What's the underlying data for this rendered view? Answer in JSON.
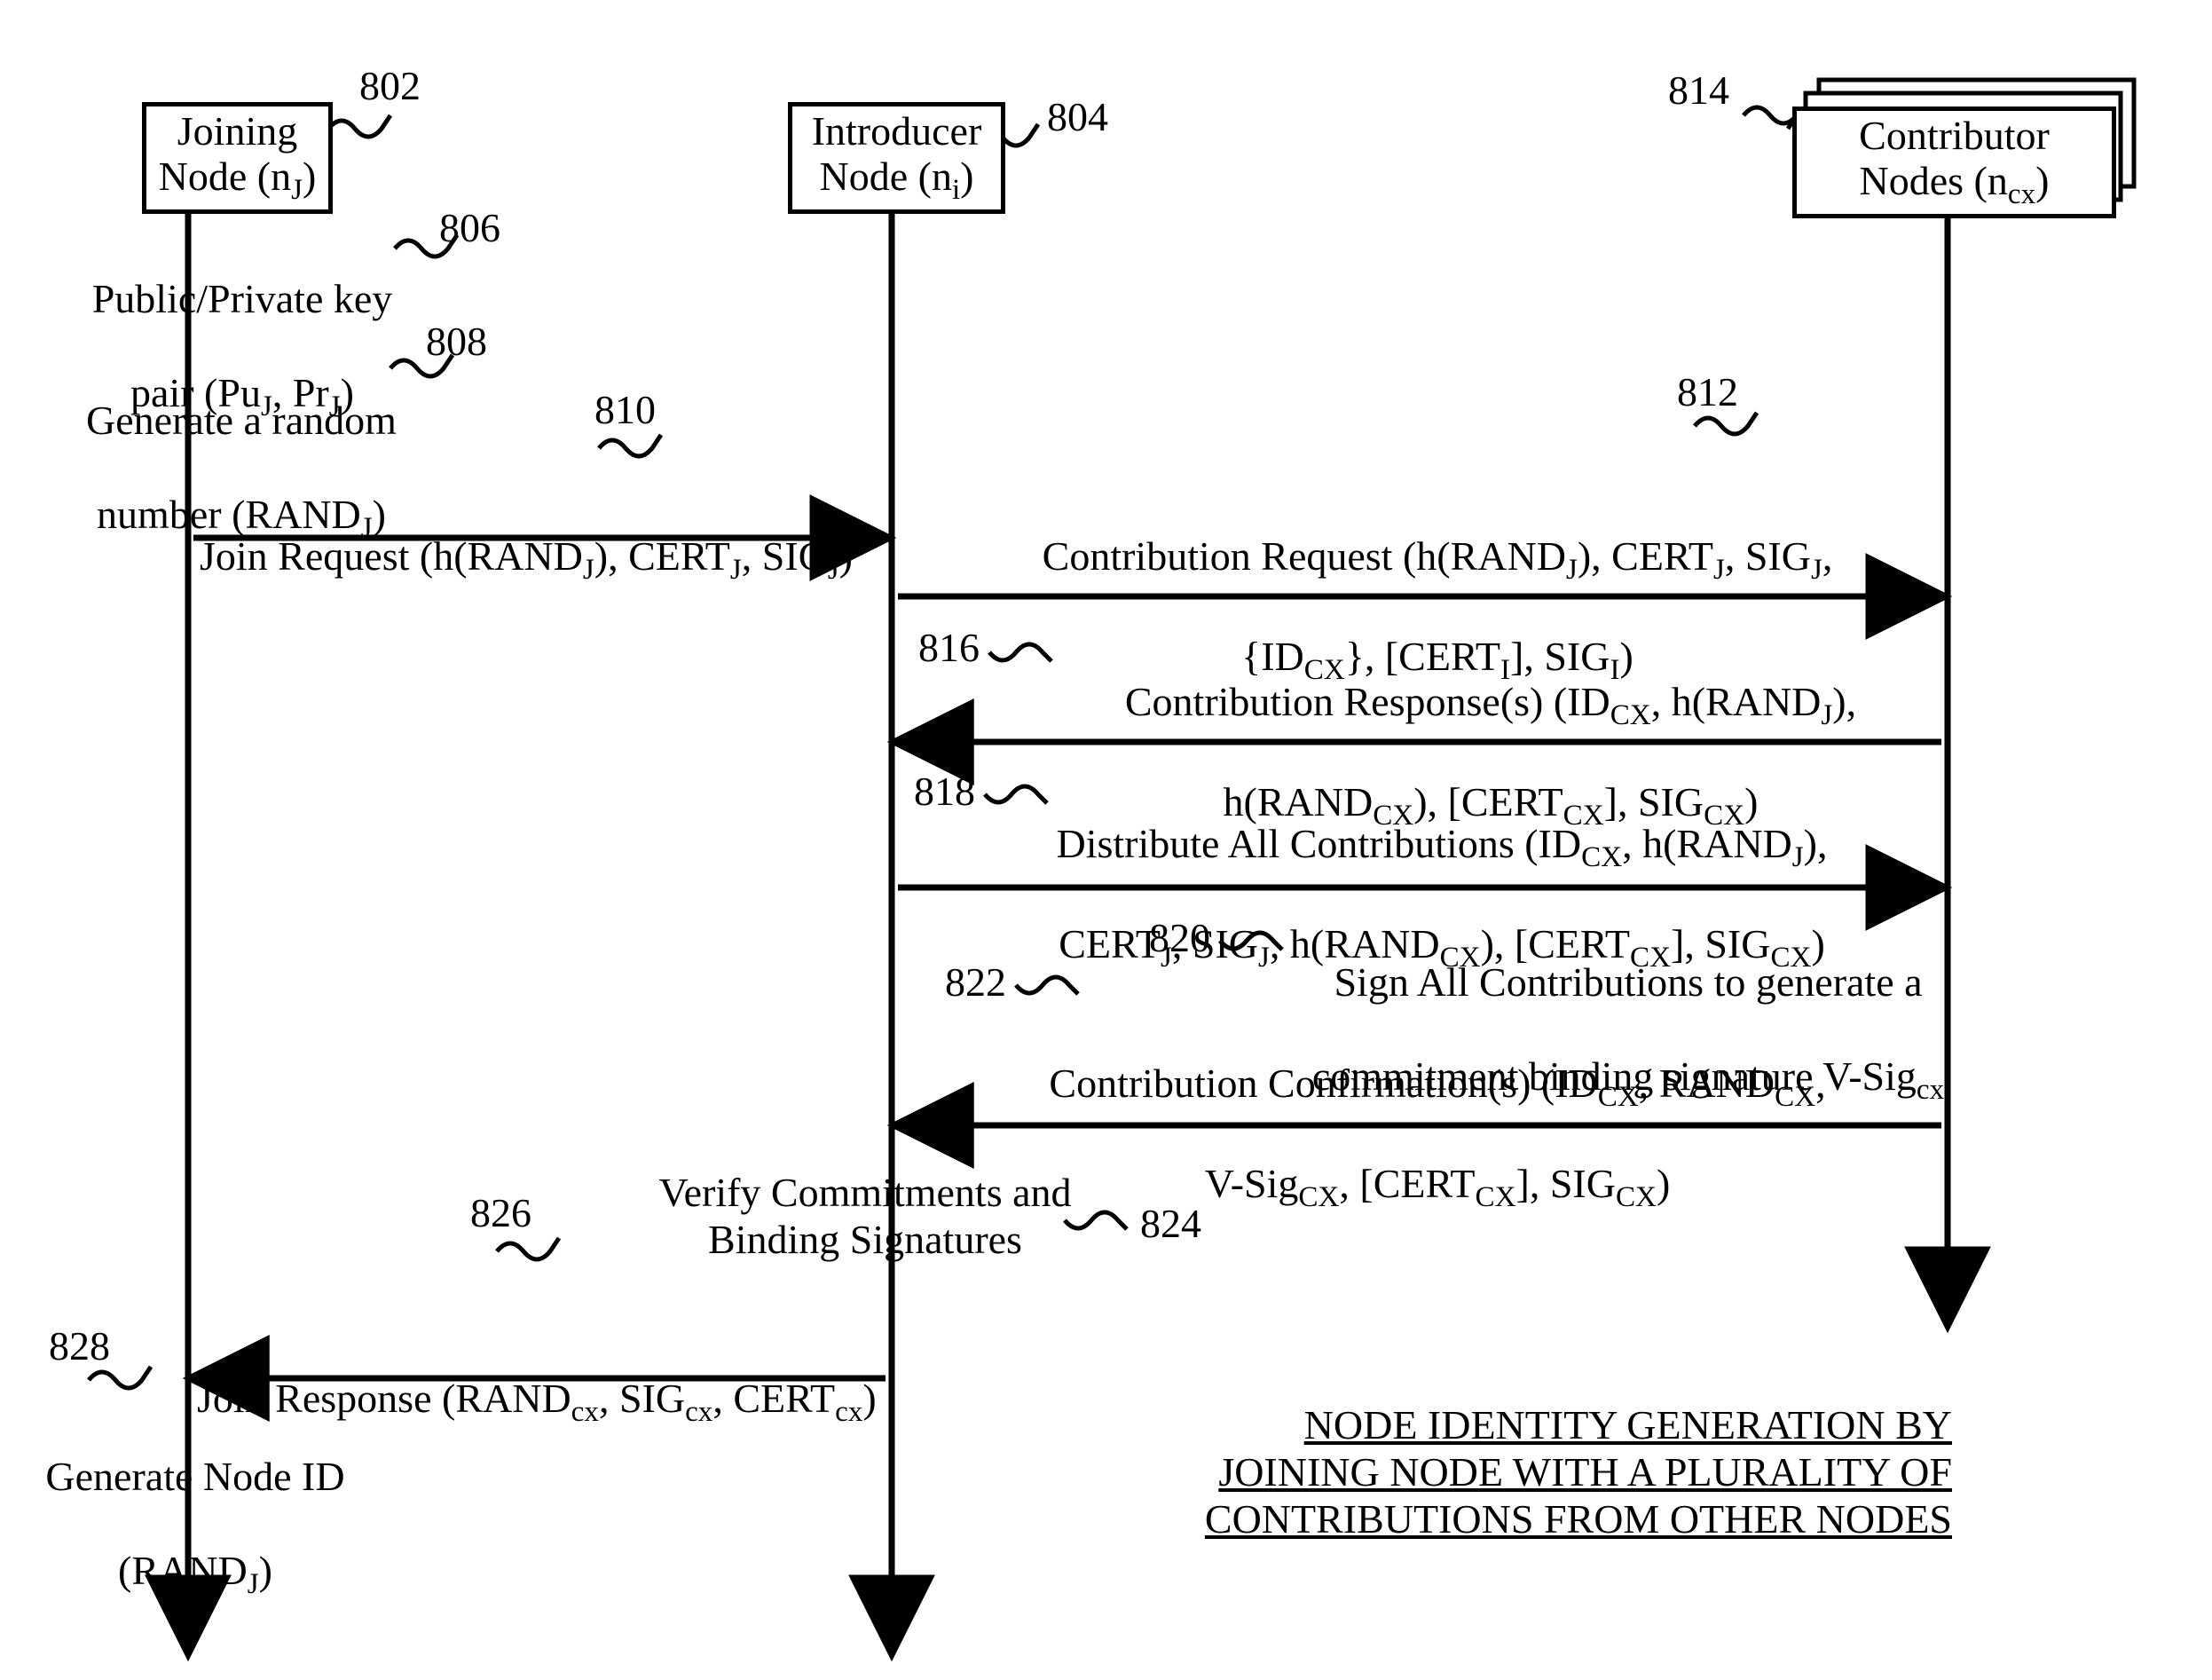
{
  "chart_data": {
    "type": "sequence-diagram",
    "participants": [
      {
        "id": "joining",
        "label": "Joining\nNode (n_J)",
        "ref": "802"
      },
      {
        "id": "introducer",
        "label": "Introducer\nNode (n_i)",
        "ref": "804"
      },
      {
        "id": "contributors",
        "label": "Contributor\nNodes (n_cx)",
        "ref": "814"
      }
    ],
    "steps": [
      {
        "ref": "806",
        "at": "joining",
        "text": "Public/Private key pair (Pu_J, Pr_J)"
      },
      {
        "ref": "808",
        "at": "joining",
        "text": "Generate a random number (RAND_J)"
      },
      {
        "ref": "810",
        "from": "joining",
        "to": "introducer",
        "text": "Join Request (h(RAND_J), CERT_J, SIG_J)"
      },
      {
        "ref": "812",
        "from": "introducer",
        "to": "contributors",
        "text": "Contribution Request (h(RAND_J), CERT_J, SIG_J, {ID_CX}, [CERT_I], SIG_I)"
      },
      {
        "ref": "816",
        "from": "contributors",
        "to": "introducer",
        "text": "Contribution Response(s) (ID_CX, h(RAND_J), h(RAND_CX), [CERT_CX], SIG_CX)"
      },
      {
        "ref": "818",
        "from": "introducer",
        "to": "contributors",
        "text": "Distribute All Contributions (ID_CX, h(RAND_J), CERT_J, SIG_J, h(RAND_CX), [CERT_CX], SIG_CX)"
      },
      {
        "ref": "820",
        "at": "contributors",
        "text": "Sign All Contributions to generate a commitment binding signature V-Sig_cx"
      },
      {
        "ref": "822",
        "from": "contributors",
        "to": "introducer",
        "text": "Contribution Confirmation(s) (ID_CX, RAND_CX, V-Sig_CX, [CERT_CX], SIG_CX)"
      },
      {
        "ref": "824",
        "at": "introducer",
        "text": "Verify Commitments and Binding Signatures"
      },
      {
        "ref": "826",
        "from": "introducer",
        "to": "joining",
        "text": "Join Response (RAND_cx, SIG_cx, CERT_cx)"
      },
      {
        "ref": "828",
        "at": "joining",
        "text": "Generate Node ID (RAND_J)"
      }
    ],
    "title": "NODE IDENTITY GENERATION BY JOINING NODE WITH A PLURALITY OF CONTRIBUTIONS FROM OTHER NODES"
  },
  "joining_label": "Joining\nNode (n",
  "joining_sub": "J",
  "introducer_label": "Introducer\nNode (n",
  "introducer_sub": "i",
  "contributor_label": "Contributor\nNodes (n",
  "contributor_sub": "cx",
  "step806_a": "Public/Private key",
  "step806_b": "pair (Pu",
  "step806_c": ", Pr",
  "step808_a": "Generate a random",
  "step808_b": "number (RAND",
  "step810_a": "Join Request (h(RAND",
  "step810_b": "), CERT",
  "step810_c": ", SIG",
  "step812_a": "Contribution Request (h(RAND",
  "step812_b": "), CERT",
  "step812_c": ", SIG",
  "step812_d": "{ID",
  "step812_e": "}, [CERT",
  "step812_f": "], SIG",
  "step816_a": "Contribution Response(s) (ID",
  "step816_b": ", h(RAND",
  "step816_c": "h(RAND",
  "step816_d": "), [CERT",
  "step816_e": "], SIG",
  "step818_a": "Distribute All Contributions (ID",
  "step818_b": ", h(RAND",
  "step818_c": "CERT",
  "step818_d": ", SIG",
  "step818_e": ",  h(RAND",
  "step818_f": "), [CERT",
  "step818_g": "], SIG",
  "step820_a": "Sign All Contributions to generate a",
  "step820_b": "commitment binding signature V-Sig",
  "step822_a": "Contribution Confirmation(s) (ID",
  "step822_b": ", RAND",
  "step822_c": "V-Sig",
  "step822_d": ", [CERT",
  "step822_e": "], SIG",
  "step824": "Verify Commitments and\nBinding Signatures",
  "step826_a": "Join Response (RAND",
  "step826_b": ", SIG",
  "step826_c": ", CERT",
  "step828_a": "Generate Node ID",
  "step828_b": "(RAND",
  "ref802": "802",
  "ref804": "804",
  "ref806": "806",
  "ref808": "808",
  "ref810": "810",
  "ref812": "812",
  "ref814": "814",
  "ref816": "816",
  "ref818": "818",
  "ref820": "820",
  "ref822": "822",
  "ref824": "824",
  "ref826": "826",
  "ref828": "828",
  "title_caption": "NODE IDENTITY GENERATION BY\nJOINING NODE WITH A PLURALITY OF\nCONTRIBUTIONS FROM OTHER NODES",
  "sub_J": "J",
  "sub_I": "I",
  "sub_CX": "CX",
  "sub_cx": "cx",
  "paren": ")"
}
